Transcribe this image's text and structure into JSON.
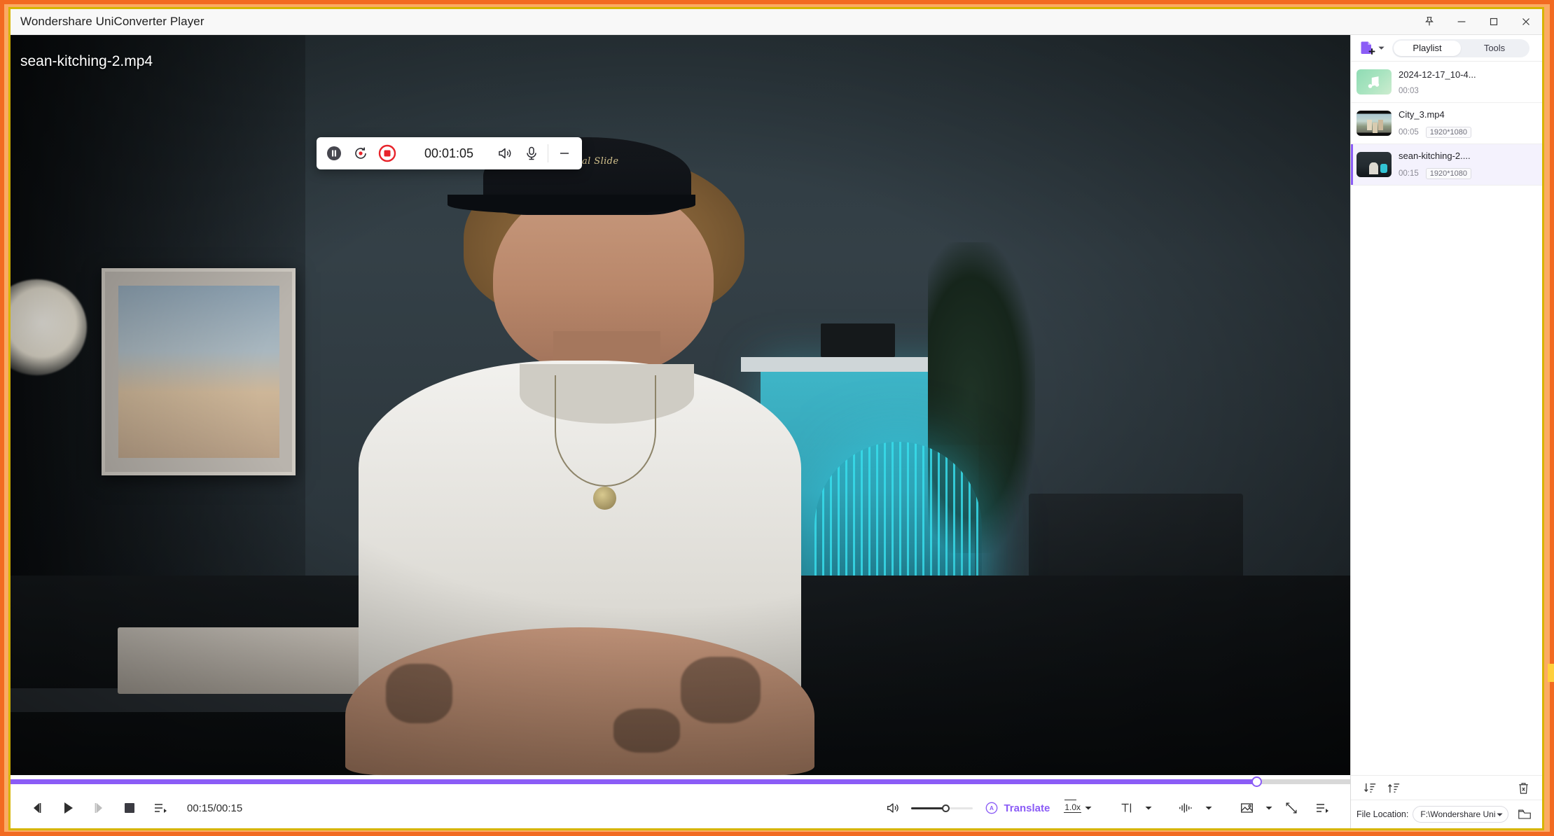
{
  "window": {
    "title": "Wondershare UniConverter Player",
    "controls": [
      {
        "name": "pin",
        "label": "Pin"
      },
      {
        "name": "minimize",
        "label": "Minimize"
      },
      {
        "name": "maximize",
        "label": "Maximize"
      },
      {
        "name": "close",
        "label": "Close"
      }
    ]
  },
  "player": {
    "filename": "sean-kitching-2.mp4",
    "current_time": "00:15",
    "total_time": "00:15",
    "time_display": "00:15/00:15",
    "progress_percent": 93,
    "volume_percent": 55,
    "speed_label": "1.0x",
    "translate_label": "Translate",
    "accent_color": "#8b5cf6",
    "buttons": [
      {
        "name": "previous-frame",
        "label": "Previous"
      },
      {
        "name": "play",
        "label": "Play"
      },
      {
        "name": "next-frame",
        "label": "Next"
      },
      {
        "name": "stop",
        "label": "Stop"
      },
      {
        "name": "playlist-toggle",
        "label": "Playlist"
      }
    ],
    "right_tools": [
      {
        "name": "volume",
        "label": "Volume"
      },
      {
        "name": "translate",
        "label": "Translate"
      },
      {
        "name": "speed",
        "label": "1.0x"
      },
      {
        "name": "subtitle",
        "label": "Subtitle"
      },
      {
        "name": "audio-track",
        "label": "Audio track"
      },
      {
        "name": "snapshot",
        "label": "Snapshot"
      },
      {
        "name": "fullscreen",
        "label": "Full screen"
      },
      {
        "name": "playlist",
        "label": "Playlist"
      }
    ]
  },
  "recorder": {
    "elapsed": "00:01:05",
    "buttons": [
      {
        "name": "pause-recording",
        "label": "Pause"
      },
      {
        "name": "restart-recording",
        "label": "Restart"
      },
      {
        "name": "stop-recording",
        "label": "Stop"
      },
      {
        "name": "system-audio",
        "label": "System audio"
      },
      {
        "name": "microphone",
        "label": "Microphone"
      },
      {
        "name": "minimize-recorder",
        "label": "Minimize"
      }
    ],
    "stop_color": "#e8232a"
  },
  "sidebar": {
    "add_file_label": "Add file",
    "tabs": [
      {
        "label": "Playlist",
        "active": true
      },
      {
        "label": "Tools",
        "active": false
      }
    ],
    "items": [
      {
        "name": "2024-12-17_10-4...",
        "duration": "00:03",
        "resolution": "",
        "type": "audio",
        "selected": false
      },
      {
        "name": "City_3.mp4",
        "duration": "00:05",
        "resolution": "1920*1080",
        "type": "video",
        "selected": false
      },
      {
        "name": "sean-kitching-2....",
        "duration": "00:15",
        "resolution": "1920*1080",
        "type": "video",
        "selected": true
      }
    ],
    "tools": [
      {
        "name": "sort-descending",
        "label": "Sort descending"
      },
      {
        "name": "sort-ascending",
        "label": "Sort ascending"
      },
      {
        "name": "delete-all",
        "label": "Delete all"
      }
    ],
    "file_location_label": "File Location:",
    "file_location_value": "F:\\Wondershare Uni",
    "open_folder_label": "Open folder"
  }
}
